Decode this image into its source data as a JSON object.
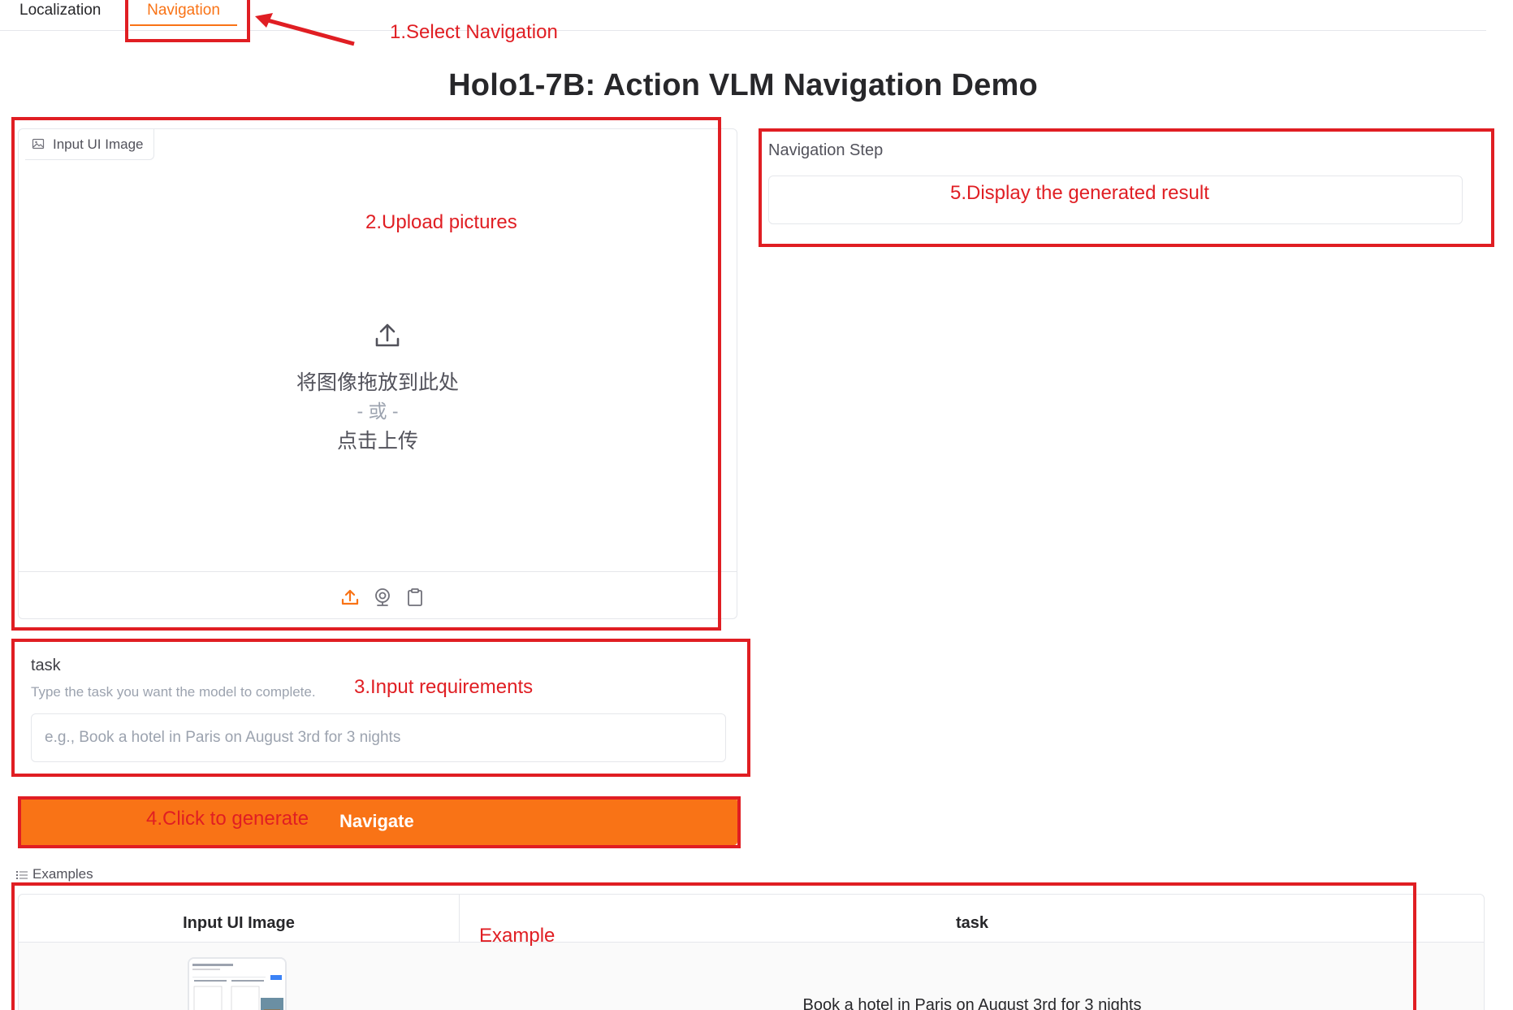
{
  "tabs": [
    {
      "label": "Localization",
      "active": false
    },
    {
      "label": "Navigation",
      "active": true
    }
  ],
  "title": "Holo1-7B: Action VLM Navigation Demo",
  "image_input": {
    "label": "Input UI Image",
    "drop_text": "将图像拖放到此处",
    "or_text": "- 或 -",
    "click_text": "点击上传",
    "tools": [
      "upload-icon",
      "webcam-icon",
      "clipboard-icon"
    ]
  },
  "output": {
    "label": "Navigation Step",
    "value": ""
  },
  "task": {
    "label": "task",
    "info": "Type the task you want the model to complete.",
    "placeholder": "e.g., Book a hotel in Paris on August 3rd for 3 nights",
    "value": ""
  },
  "navigate_button": {
    "label": "Navigate"
  },
  "examples": {
    "label": "Examples",
    "headers": [
      "Input UI Image",
      "task"
    ],
    "rows": [
      {
        "task": "Book a hotel in Paris on August 3rd for 3 nights"
      }
    ]
  },
  "annotations": {
    "step1": "1.Select Navigation",
    "step2": "2.Upload pictures",
    "step3": "3.Input requirements",
    "step4": "4.Click to generate",
    "step5": "5.Display the generated result",
    "example": "Example"
  },
  "colors": {
    "accent": "#f97316",
    "annotation": "#e01e23",
    "border": "#e5e7eb"
  }
}
